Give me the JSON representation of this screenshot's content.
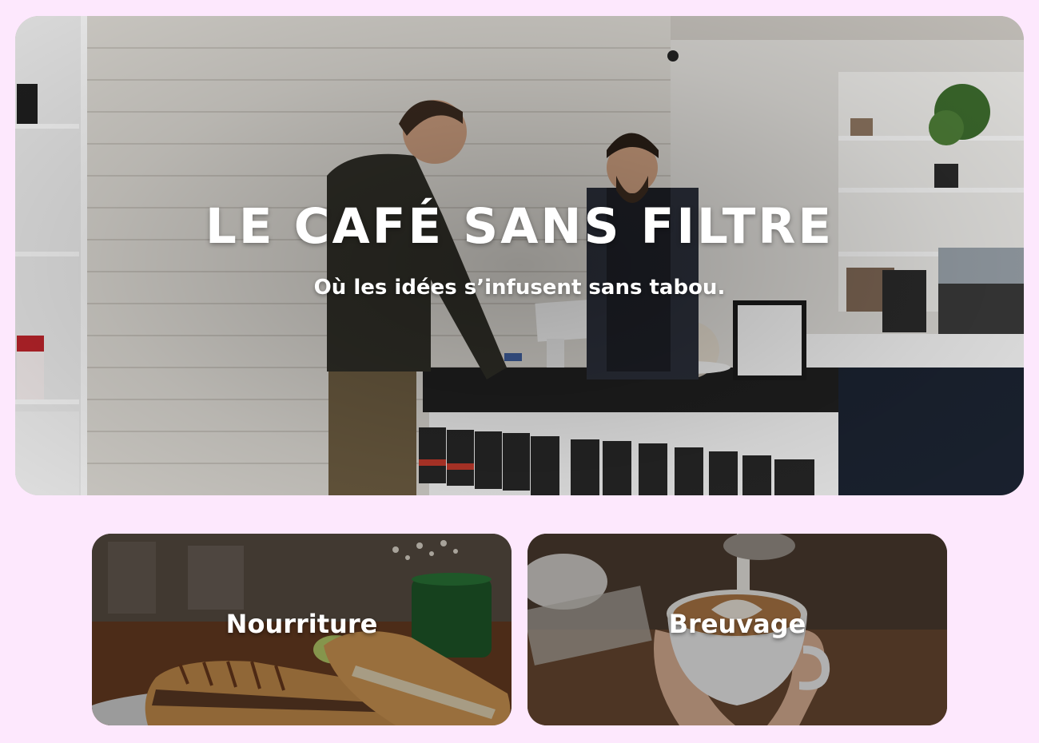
{
  "hero": {
    "title": "LE CAFÉ SANS FILTRE",
    "subtitle": "Où les idées s’infusent sans tabou.",
    "image": "cafe-counter-photo"
  },
  "cards": [
    {
      "label": "Nourriture",
      "image": "sandwich-photo"
    },
    {
      "label": "Breuvage",
      "image": "latte-art-photo"
    }
  ],
  "colors": {
    "page_background": "#fde8fd",
    "text": "#ffffff"
  }
}
